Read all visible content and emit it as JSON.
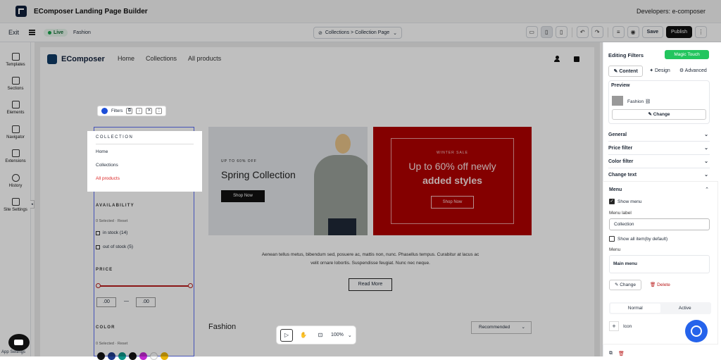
{
  "app": {
    "title": "EComposer Landing Page Builder",
    "developers": "Developers:  e-composer"
  },
  "toolbar": {
    "exit": "Exit",
    "live": "Live",
    "page_name": "Fashion",
    "breadcrumb": "Collections  >  Collection Page",
    "save": "Save",
    "publish": "Publish"
  },
  "left_nav": [
    {
      "label": "Templates",
      "icon": "templates-icon"
    },
    {
      "label": "Sections",
      "icon": "sections-icon"
    },
    {
      "label": "Elements",
      "icon": "elements-icon"
    },
    {
      "label": "Navigator",
      "icon": "navigator-icon"
    },
    {
      "label": "Extensions",
      "icon": "extensions-icon"
    },
    {
      "label": "History",
      "icon": "history-icon"
    },
    {
      "label": "Site Settings",
      "icon": "site-settings-icon"
    }
  ],
  "app_settings": "App Settings",
  "site": {
    "logo": "EComposer",
    "nav": [
      "Home",
      "Collections",
      "All products"
    ]
  },
  "filters_pill": "Filters",
  "collection": {
    "title": "COLLECTION",
    "items": [
      "Home",
      "Collections",
      "All products"
    ]
  },
  "availability": {
    "title": "AVAILABILITY",
    "meta": "0 Selected  ·  Reset",
    "options": [
      "in stock (14)",
      "out of stock (5)"
    ]
  },
  "price": {
    "title": "PRICE",
    "min": ".00",
    "dash": "—",
    "max": ".00"
  },
  "color": {
    "title": "COLOR",
    "meta": "0 Selected  ·  Reset",
    "swatches": [
      "#111111",
      "#1e3a8a",
      "#0d9488",
      "#111111",
      "#c026d3",
      "#f9fafb",
      "#eab308"
    ]
  },
  "hero1": {
    "small": "UP TO 60% OFF",
    "big": "Spring Collection",
    "button": "Shop Now"
  },
  "hero2": {
    "small": "WINTER SALE",
    "big": "Up to 60% off newly",
    "big2": "added styles",
    "button": "Shop Now"
  },
  "paragraph": "Aenean tellus metus, bibendum sed, posuere ac, mattis non, nunc. Phasellus tempus. Curabitur at lacus ac velit ornare lobortis. Suspendisse feugiat. Nunc nec neque.",
  "read_more": "Read More",
  "fashion_heading": "Fashion",
  "sort": "Recommended",
  "zoom": "100%",
  "right_panel": {
    "title": "Editing Filters",
    "magic": "Magic Touch",
    "tabs": [
      "Content",
      "Design",
      "Advanced"
    ],
    "preview_label": "Preview",
    "preview_name": "Fashion",
    "change": "Change",
    "accordions": [
      "General",
      "Price filter",
      "Color filter",
      "Change text"
    ],
    "menu": {
      "title": "Menu",
      "show_menu": "Show menu",
      "menu_label_lbl": "Menu label",
      "menu_label_val": "Collection",
      "show_all": "Show all item(by default)",
      "menu_lbl": "Menu",
      "main_menu": "Main menu",
      "change": "Change",
      "delete": "Delete",
      "seg": [
        "Normal",
        "Active"
      ],
      "icon": "Icon"
    }
  }
}
